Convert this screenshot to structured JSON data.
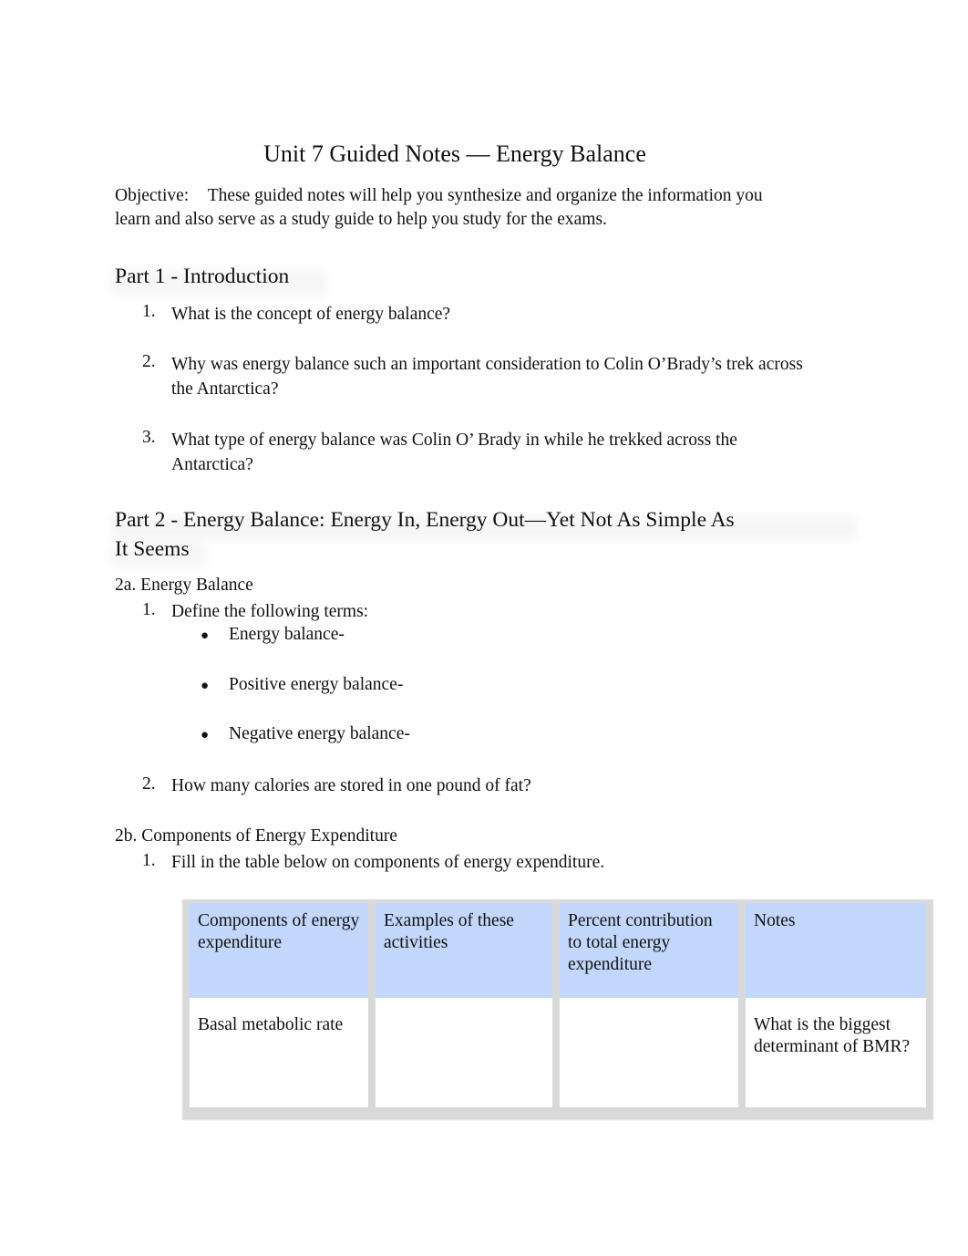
{
  "document": {
    "title": "Unit 7 Guided Notes — Energy Balance",
    "objective": {
      "label": "Objective:",
      "text": "These guided notes will help you synthesize and organize the information you learn and also serve as a study guide to help you study for the exams."
    },
    "part1": {
      "heading": "Part 1 - Introduction",
      "questions": [
        {
          "number": "1.",
          "text": "What is the concept of energy balance?"
        },
        {
          "number": "2.",
          "text": "Why was energy balance such an important consideration to Colin O’Brady’s trek across the Antarctica?"
        },
        {
          "number": "3.",
          "text": "What type of energy balance was Colin O’ Brady in while he trekked across the Antarctica?"
        }
      ]
    },
    "part2": {
      "heading_line1": "Part 2 - Energy Balance: Energy In, Energy Out—Yet Not As Simple As",
      "heading_line2": "It Seems",
      "section_2a": {
        "title": "2a. Energy Balance",
        "items": [
          {
            "number": "1.",
            "text": "Define the following terms:"
          },
          {
            "number": "2.",
            "text": "How many calories are stored in one pound of fat?"
          }
        ],
        "terms": [
          "Energy balance-",
          "Positive energy balance-",
          "Negative energy balance-"
        ],
        "bullet": "●"
      },
      "section_2b": {
        "title": "2b. Components of Energy Expenditure",
        "items": [
          {
            "number": "1.",
            "text": "Fill in the table below on components of energy expenditure."
          }
        ],
        "table": {
          "headers": [
            "Components of energy expenditure",
            "Examples of these activities",
            "Percent contribution to total energy expenditure",
            "Notes"
          ],
          "rows": [
            [
              "Basal metabolic rate",
              "",
              "",
              "What is the biggest determinant of BMR?"
            ]
          ]
        }
      }
    }
  },
  "colors": {
    "table_header_bg": "#c3d6fb",
    "text": "#111111"
  }
}
